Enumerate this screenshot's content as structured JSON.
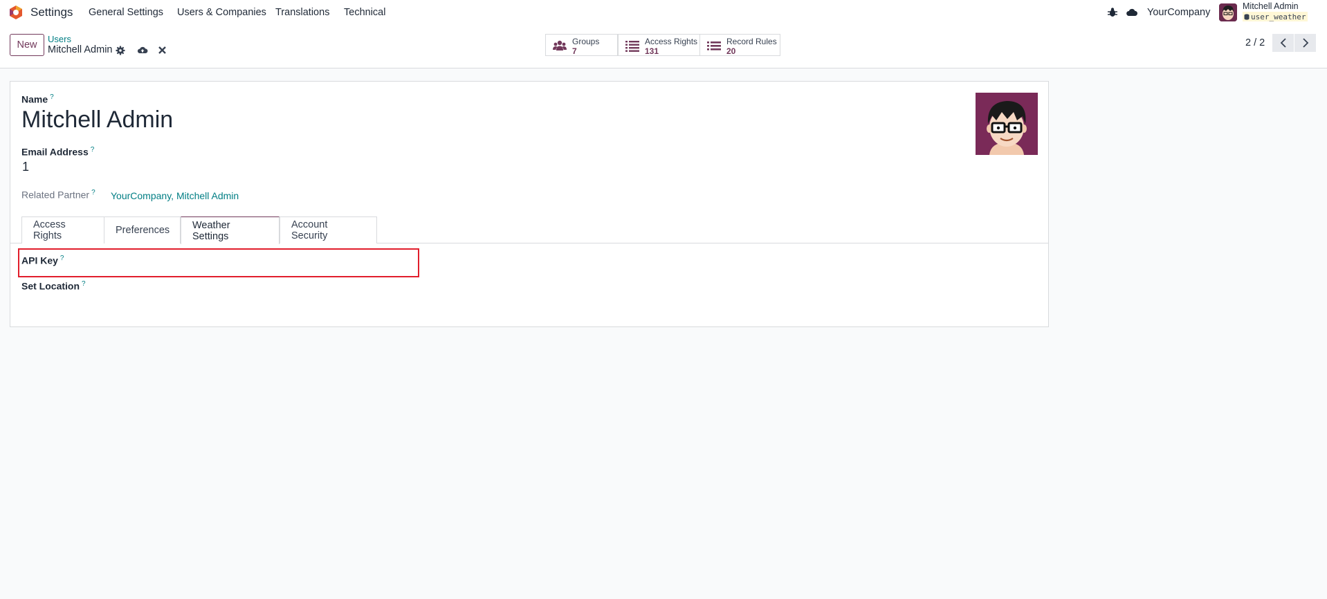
{
  "navbar": {
    "app_name": "Settings",
    "menu": [
      "General Settings",
      "Users & Companies",
      "Translations",
      "Technical"
    ],
    "company": "YourCompany",
    "user_name": "Mitchell Admin",
    "database": "user_weather",
    "icons": [
      "odoo-logo-icon",
      "bug-icon",
      "cloud-icon"
    ]
  },
  "control_panel": {
    "new_button": "New",
    "breadcrumb_parent": "Users",
    "breadcrumb_current": "Mitchell Admin",
    "actions": [
      "gear-icon",
      "cloud-upload-icon",
      "close-icon"
    ],
    "stats": [
      {
        "label": "Groups",
        "value": "7",
        "icon": "users-icon"
      },
      {
        "label": "Access Rights",
        "value": "131",
        "icon": "list-icon"
      },
      {
        "label": "Record Rules",
        "value": "20",
        "icon": "list-icon"
      }
    ],
    "pager": "2 / 2"
  },
  "form": {
    "name_label": "Name",
    "name_value": "Mitchell Admin",
    "email_label": "Email Address",
    "email_value": "1",
    "related_partner_label": "Related Partner",
    "related_partner_value": "YourCompany, Mitchell Admin",
    "help_mark": "?",
    "tabs": [
      "Access Rights",
      "Preferences",
      "Weather Settings",
      "Account Security"
    ],
    "active_tab": "Weather Settings",
    "weather": {
      "api_key_label": "API Key",
      "set_location_label": "Set Location"
    }
  },
  "colors": {
    "brand": "#71385a",
    "link": "#017e84",
    "highlight": "#e11d2b"
  }
}
